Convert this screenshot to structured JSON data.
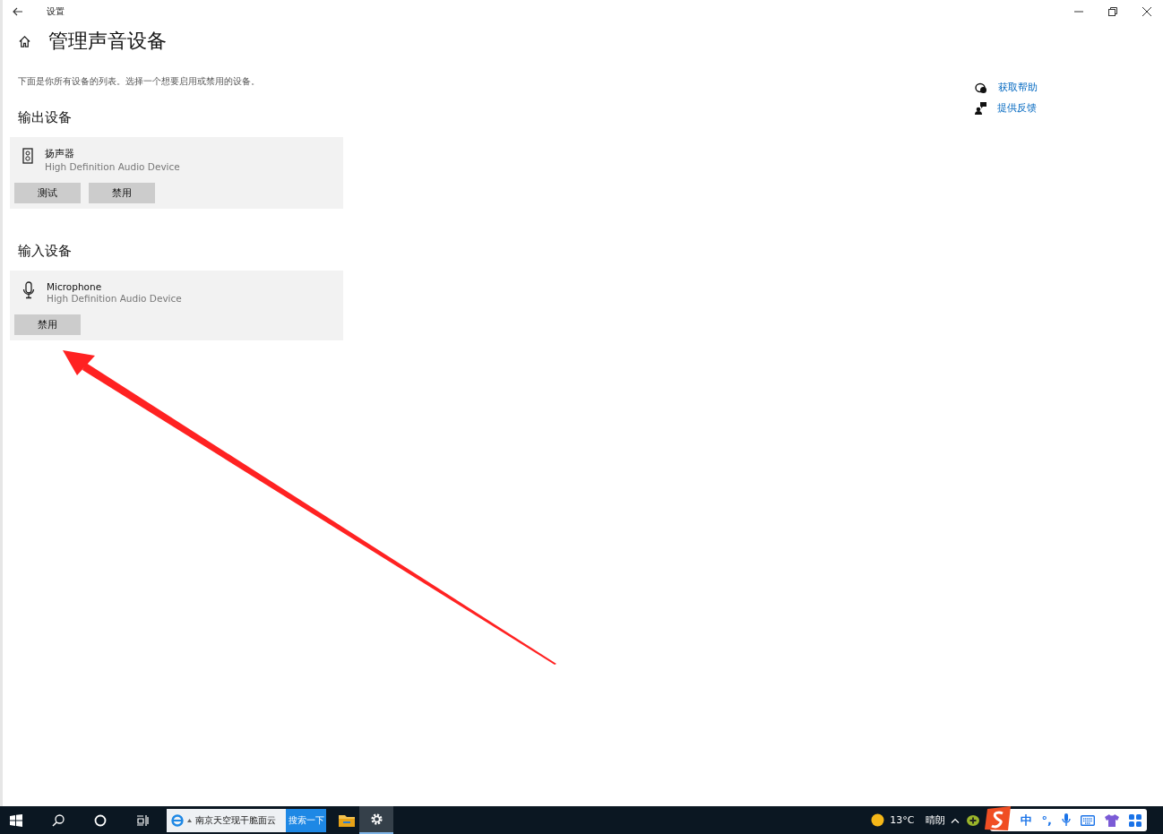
{
  "window": {
    "title": "设置"
  },
  "page": {
    "title": "管理声音设备",
    "description": "下面是你所有设备的列表。选择一个想要启用或禁用的设备。"
  },
  "links": [
    {
      "label": "获取帮助",
      "kind": "help"
    },
    {
      "label": "提供反馈",
      "kind": "feedback"
    }
  ],
  "sections": [
    {
      "heading": "输出设备",
      "devices": [
        {
          "kind": "speaker",
          "name": "扬声器",
          "driver": "High Definition Audio Device",
          "buttons": [
            "测试",
            "禁用"
          ]
        }
      ]
    },
    {
      "heading": "输入设备",
      "devices": [
        {
          "kind": "microphone",
          "name": "Microphone",
          "driver": "High Definition Audio Device",
          "buttons": [
            "禁用"
          ]
        }
      ]
    }
  ],
  "taskbar": {
    "search_text": "南京天空现干脆面云",
    "search_button": "搜索一下",
    "weather": {
      "temp": "13°C",
      "condition": "晴朗"
    },
    "ime": {
      "mode": "中",
      "punct": "°,"
    }
  }
}
